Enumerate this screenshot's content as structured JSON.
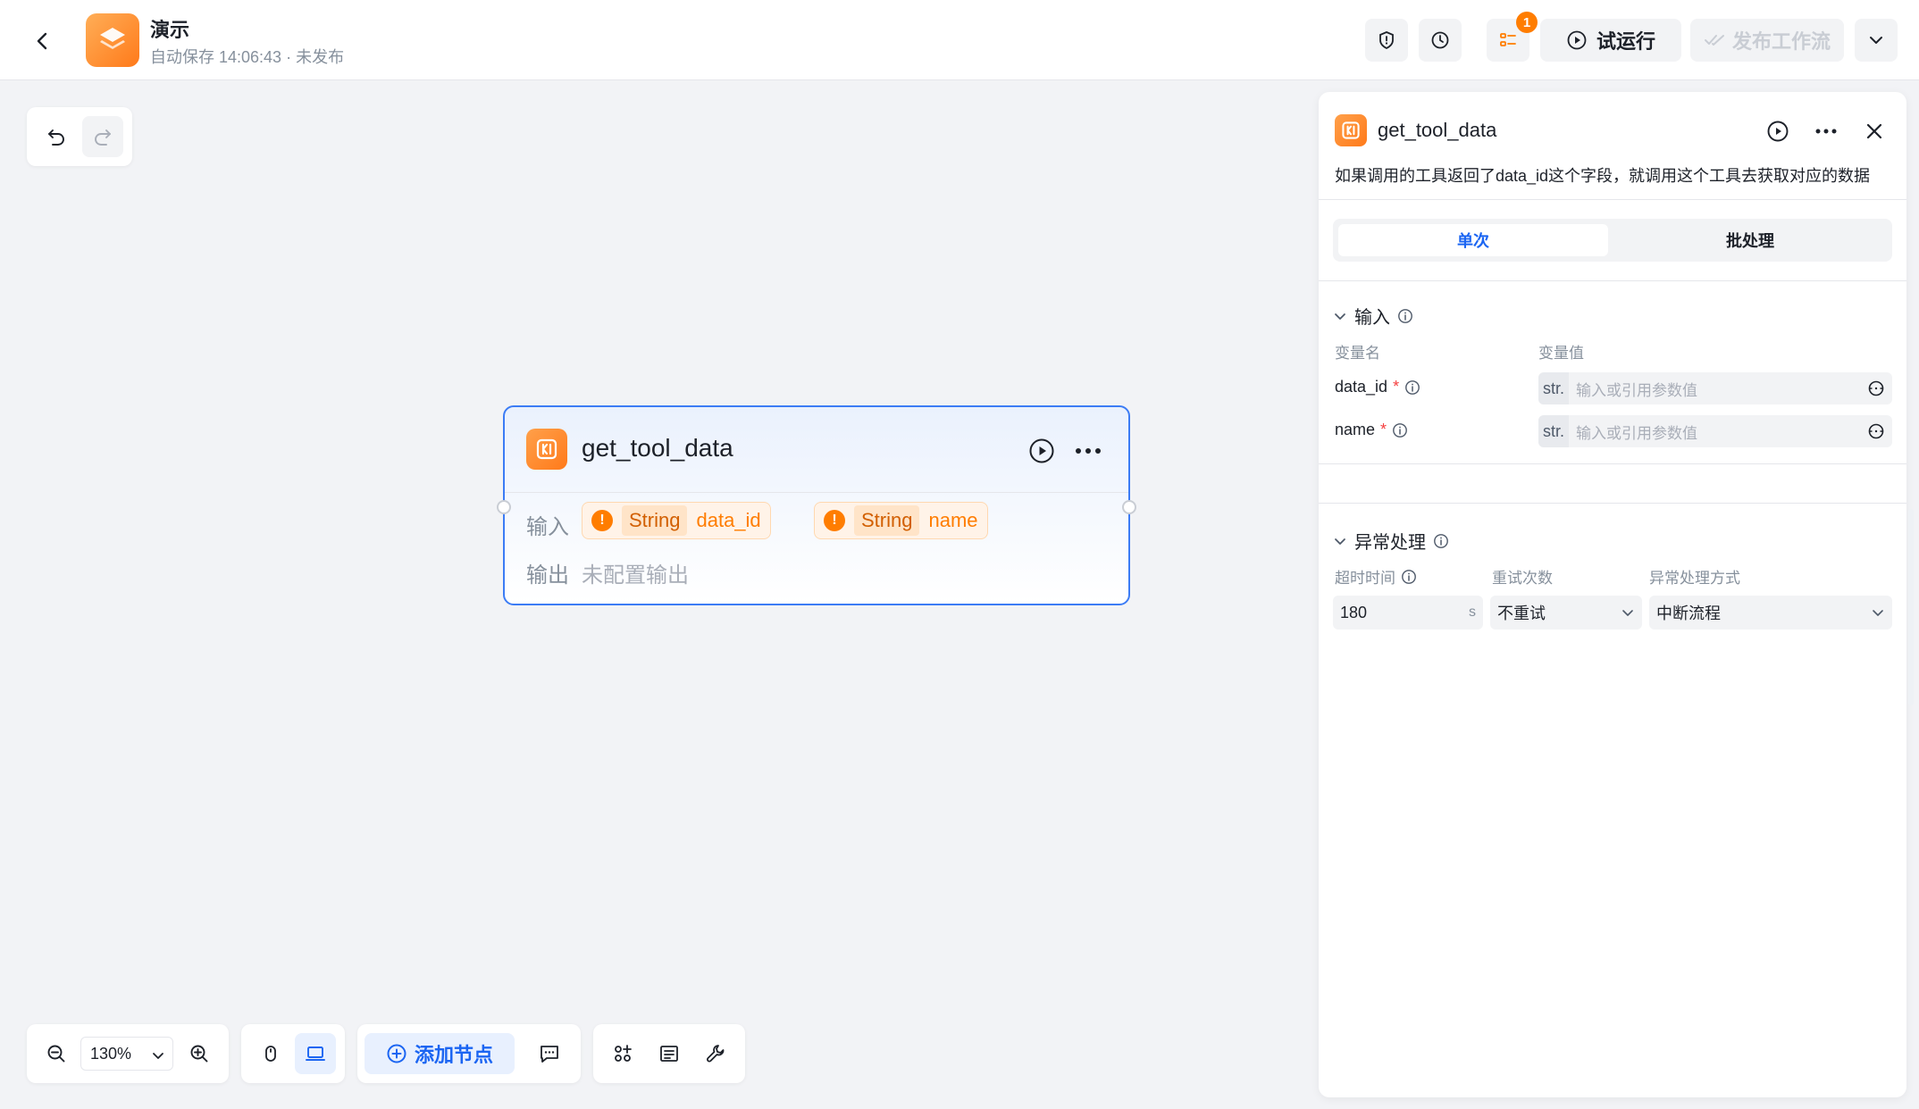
{
  "header": {
    "app_name": "演示",
    "subtitle": "自动保存 14:06:43 · 未发布",
    "notification_count": "1",
    "run_label": "试运行",
    "publish_label": "发布工作流"
  },
  "node": {
    "title": "get_tool_data",
    "input_label": "输入",
    "output_label": "输出",
    "output_value": "未配置输出",
    "inputs": [
      {
        "type": "String",
        "name": "data_id"
      },
      {
        "type": "String",
        "name": "name"
      }
    ]
  },
  "toolbar": {
    "zoom": "130%",
    "add_node_label": "添加节点"
  },
  "panel": {
    "title": "get_tool_data",
    "description": "如果调用的工具返回了data_id这个字段，就调用这个工具去获取对应的数据",
    "tabs": [
      "单次",
      "批处理"
    ],
    "input_section": "输入",
    "col_var_name": "变量名",
    "col_var_value": "变量值",
    "variables": [
      {
        "name": "data_id",
        "type_tag": "str.",
        "placeholder": "输入或引用参数值"
      },
      {
        "name": "name",
        "type_tag": "str.",
        "placeholder": "输入或引用参数值"
      }
    ],
    "exception_section": "异常处理",
    "timeout_label": "超时时间",
    "retry_label": "重试次数",
    "handling_label": "异常处理方式",
    "timeout_value": "180",
    "timeout_unit": "s",
    "retry_value": "不重试",
    "handling_value": "中断流程"
  },
  "colors": {
    "accent": "#1b65f2",
    "brand_orange": "#ff7d00",
    "node_border": "#3c7cf5"
  }
}
